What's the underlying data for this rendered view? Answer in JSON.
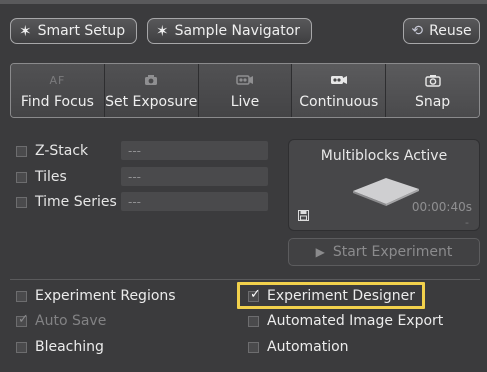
{
  "toolbar": {
    "smart_setup": "Smart Setup",
    "sample_navigator": "Sample Navigator",
    "reuse": "Reuse"
  },
  "acquisition": {
    "buttons": [
      {
        "label": "Find Focus",
        "icon": "AF"
      },
      {
        "label": "Set Exposure",
        "icon": "camera"
      },
      {
        "label": "Live",
        "icon": "video-camera"
      },
      {
        "label": "Continuous",
        "icon": "video-camera"
      },
      {
        "label": "Snap",
        "icon": "camera"
      }
    ]
  },
  "dimensions": {
    "z_stack": {
      "label": "Z-Stack",
      "value": "---"
    },
    "tiles": {
      "label": "Tiles",
      "value": "---"
    },
    "time_series": {
      "label": "Time Series",
      "value": "---"
    }
  },
  "multiblocks": {
    "title": "Multiblocks Active",
    "time": "00:00:40s",
    "dash": "-"
  },
  "start_experiment": "Start Experiment",
  "options": {
    "experiment_regions": "Experiment Regions",
    "auto_save": "Auto Save",
    "bleaching": "Bleaching",
    "experiment_designer": "Experiment Designer",
    "automated_image_export": "Automated Image Export",
    "automation": "Automation"
  },
  "colors": {
    "background": "#3b3b3d",
    "highlight": "#f2d14c"
  }
}
